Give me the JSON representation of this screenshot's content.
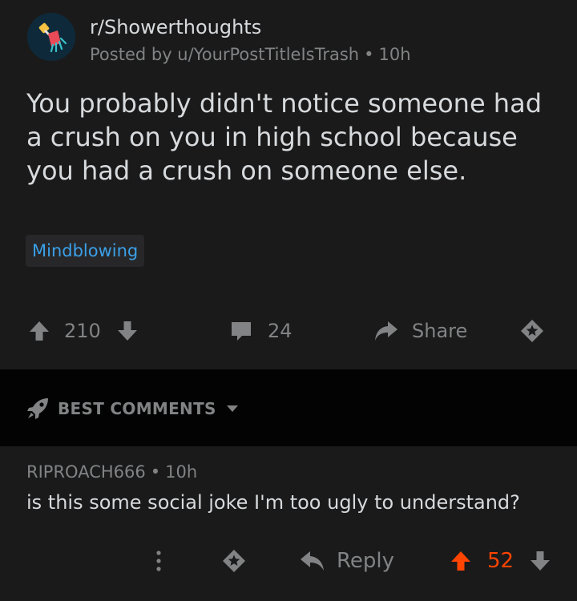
{
  "post": {
    "subreddit": "r/Showerthoughts",
    "posted_by": "Posted by u/YourPostTitleIsTrash",
    "age": "10h",
    "title": "You probably didn't notice someone had a crush on you in high school because you had a crush on someone else.",
    "flair": "Mindblowing",
    "votes": "210",
    "comments": "24",
    "share_label": "Share"
  },
  "comments_section": {
    "sort_label": "BEST COMMENTS"
  },
  "comment": {
    "author": "RIPROACH666",
    "age": "10h",
    "body": "is this some social joke I'm too ugly to understand?",
    "reply_label": "Reply",
    "votes": "52"
  },
  "colors": {
    "background": "#1a1a1b",
    "separator": "#030303",
    "text": "#d7dadc",
    "muted": "#818384",
    "flair_text": "#3aa0e8",
    "upvote_active": "#ff4500"
  },
  "icons": [
    "subreddit-shower-icon",
    "upvote-icon",
    "downvote-icon",
    "comment-icon",
    "share-icon",
    "award-icon",
    "rocket-icon",
    "chevron-down-icon",
    "more-icon",
    "reply-icon"
  ]
}
